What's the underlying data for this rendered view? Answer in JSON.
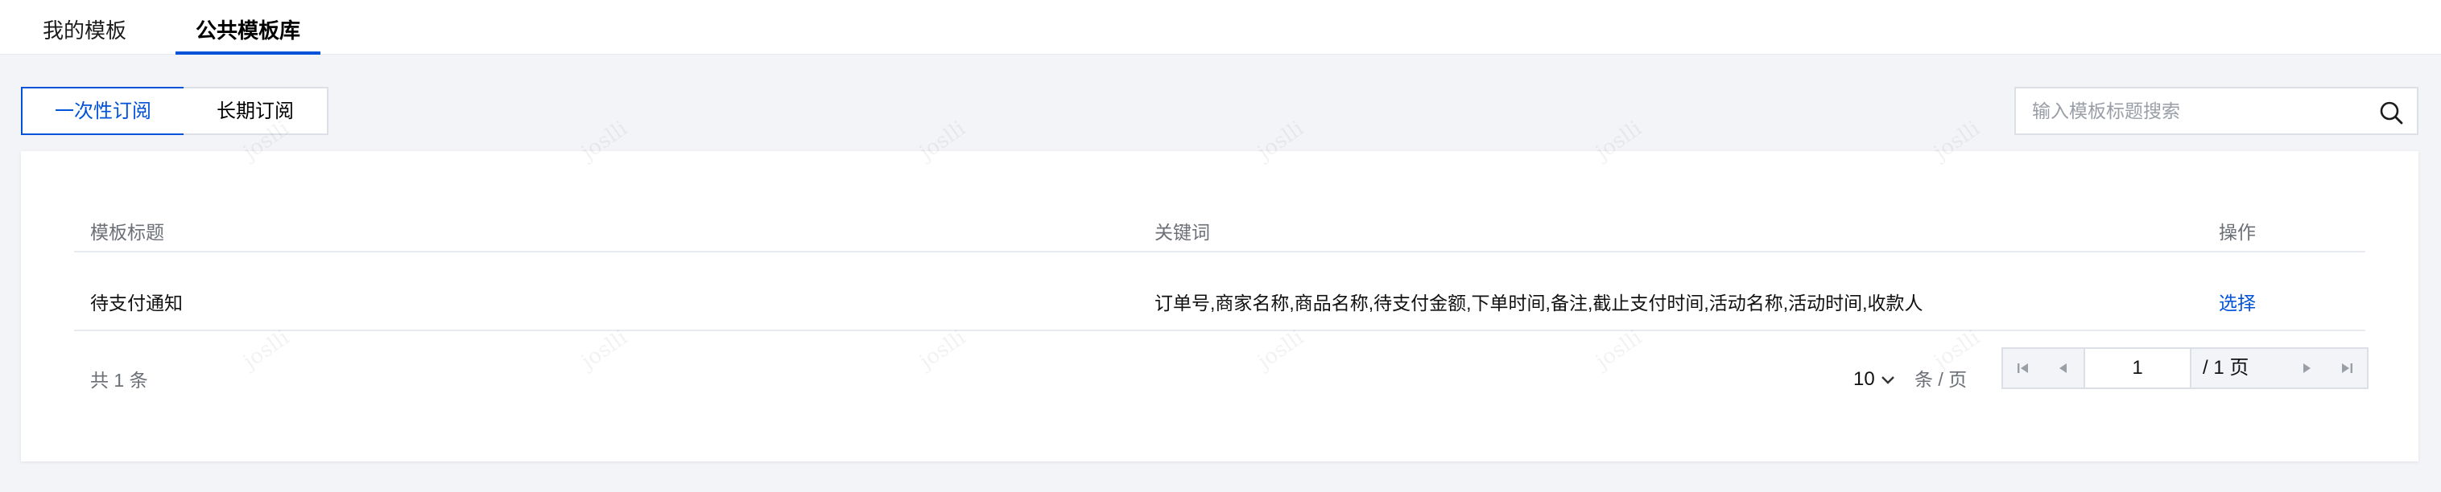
{
  "tabs": [
    {
      "label": "我的模板",
      "active": false
    },
    {
      "label": "公共模板库",
      "active": true
    }
  ],
  "subtabs": [
    {
      "label": "一次性订阅",
      "active": true
    },
    {
      "label": "长期订阅",
      "active": false
    }
  ],
  "search": {
    "placeholder": "输入模板标题搜索",
    "value": ""
  },
  "table": {
    "headers": [
      "模板标题",
      "关键词",
      "操作"
    ],
    "rows": [
      {
        "title": "待支付通知",
        "keywords": "订单号,商家名称,商品名称,待支付金额,下单时间,备注,截止支付时间,活动名称,活动时间,收款人",
        "action": "选择"
      }
    ]
  },
  "pagination": {
    "total_text": "共 1 条",
    "page_size": "10",
    "per_page_suffix": "条 / 页",
    "current_page": "1",
    "total_pages_text": "/ 1 页"
  },
  "watermark_text": "joslli",
  "colors": {
    "accent": "#0052d9",
    "page_bg": "#f3f4f7",
    "border": "#dcdfe6"
  }
}
